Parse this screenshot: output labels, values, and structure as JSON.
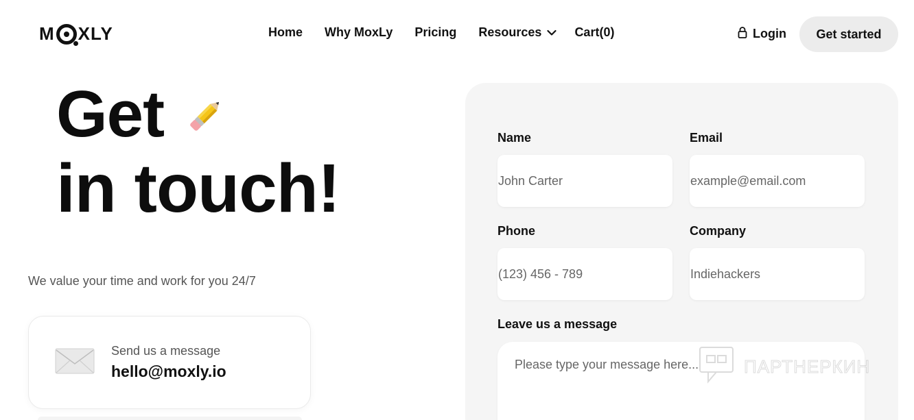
{
  "header": {
    "logo_text_left": "M",
    "logo_text_right": "XLY",
    "nav": {
      "home": "Home",
      "why": "Why MoxLy",
      "pricing": "Pricing",
      "resources": "Resources",
      "cart": "Cart(0)"
    },
    "login": "Login",
    "get_started": "Get started"
  },
  "hero": {
    "line1": "Get",
    "line2": "in touch!",
    "subtitle": "We value your time and work for you 24/7"
  },
  "contact_card": {
    "label": "Send us a message",
    "email": "hello@moxly.io"
  },
  "form": {
    "name_label": "Name",
    "name_placeholder": "John Carter",
    "email_label": "Email",
    "email_placeholder": "example@email.com",
    "phone_label": "Phone",
    "phone_placeholder": "(123) 456 - 789",
    "company_label": "Company",
    "company_placeholder": "Indiehackers",
    "message_label": "Leave us a message",
    "message_placeholder": "Please type your message here..."
  },
  "watermark": {
    "text": "ПАРТНЕРКИН"
  },
  "colors": {
    "panel_bg": "#f5f5f5",
    "button_bg": "#ececec",
    "text_primary": "#111111",
    "text_muted": "#555555"
  },
  "icons": {
    "logo_mark": "target-o-icon",
    "resources_chevron": "chevron-down-icon",
    "login_lock": "lock-icon",
    "hero_pencil": "pencil-emoji-icon",
    "contact_envelope": "envelope-icon",
    "watermark_logo": "chat-bubble-icon"
  }
}
